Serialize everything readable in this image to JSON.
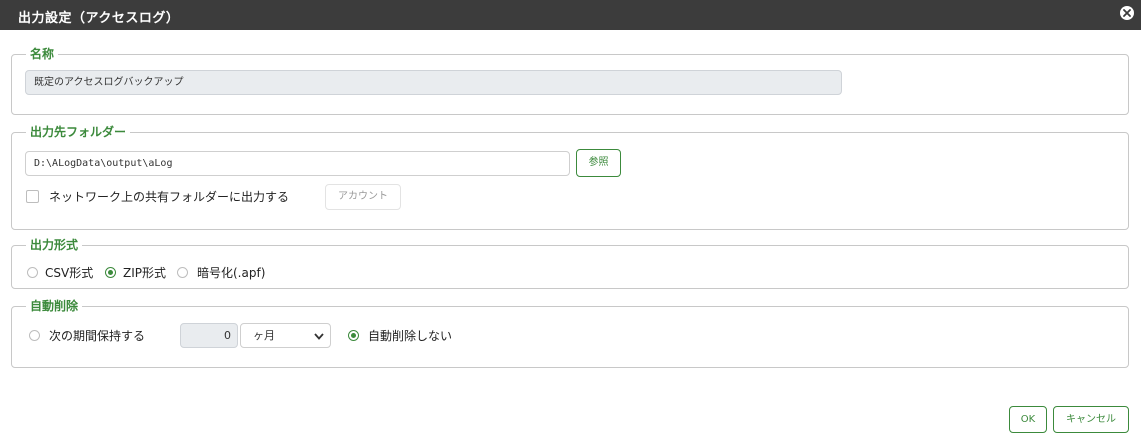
{
  "dialog": {
    "title": "出力設定（アクセスログ）",
    "close_icon": "close-circle-icon"
  },
  "name_section": {
    "legend": "名称",
    "value": "既定のアクセスログバックアップ"
  },
  "folder_section": {
    "legend": "出力先フォルダー",
    "path": "D:\\ALogData\\output\\aLog",
    "browse_label": "参照",
    "share_checkbox_label": "ネットワーク上の共有フォルダーに出力する",
    "share_checked": false,
    "account_label": "アカウント"
  },
  "format_section": {
    "legend": "出力形式",
    "options": [
      {
        "label": "CSV形式",
        "selected": false
      },
      {
        "label": "ZIP形式",
        "selected": true
      },
      {
        "label": "暗号化(.apf)",
        "selected": false
      }
    ]
  },
  "delete_section": {
    "legend": "自動削除",
    "keep_label": "次の期間保持する",
    "keep_selected": false,
    "period_value": "0",
    "unit_value": "ヶ月",
    "no_delete_label": "自動削除しない",
    "no_delete_selected": true
  },
  "footer": {
    "ok_label": "OK",
    "cancel_label": "キャンセル"
  },
  "colors": {
    "accent": "#3c8a3c",
    "titlebar": "#3c3c3c"
  }
}
